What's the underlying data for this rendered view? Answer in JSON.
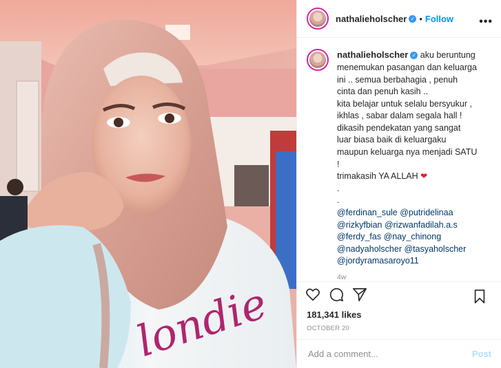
{
  "header": {
    "username": "nathalieholscher",
    "separator": "•",
    "follow_label": "Follow",
    "more_label": "•••"
  },
  "caption": {
    "username": "nathalieholscher",
    "lines": [
      "aku beruntung",
      "menemukan pasangan dan keluarga",
      "ini .. semua berbahagia , penuh",
      "cinta dan penuh kasih ..",
      "kita belajar untuk selalu bersyukur ,",
      "ikhlas , sabar dalam segala hall !",
      "dikasih pendekatan yang sangat",
      "luar biasa baik di keluargaku",
      "maupun keluarga nya menjadi SATU",
      "!",
      "trimakasih YA ALLAH",
      ".",
      "."
    ],
    "mentions": [
      "@ferdinan_sule @putridelinaa",
      "@rizkyfbian @rizwanfadilah.a.s",
      "@ferdy_fas @nay_chinong",
      "@nadyaholscher @tasyaholscher",
      "@jordyramasaroyo11"
    ],
    "age": "4w"
  },
  "likes": "181,341 likes",
  "date": "OCTOBER 20",
  "comment_box": {
    "placeholder": "Add a comment...",
    "post_label": "Post"
  },
  "icons": [
    "heart-icon",
    "comment-icon",
    "share-icon",
    "bookmark-icon",
    "verified-icon",
    "more-icon"
  ],
  "photo_text": "londie",
  "colors": {
    "link": "#0095f6",
    "verified": "#3897f0",
    "heart": "#ed1c24",
    "muted": "#8e8e8e"
  }
}
